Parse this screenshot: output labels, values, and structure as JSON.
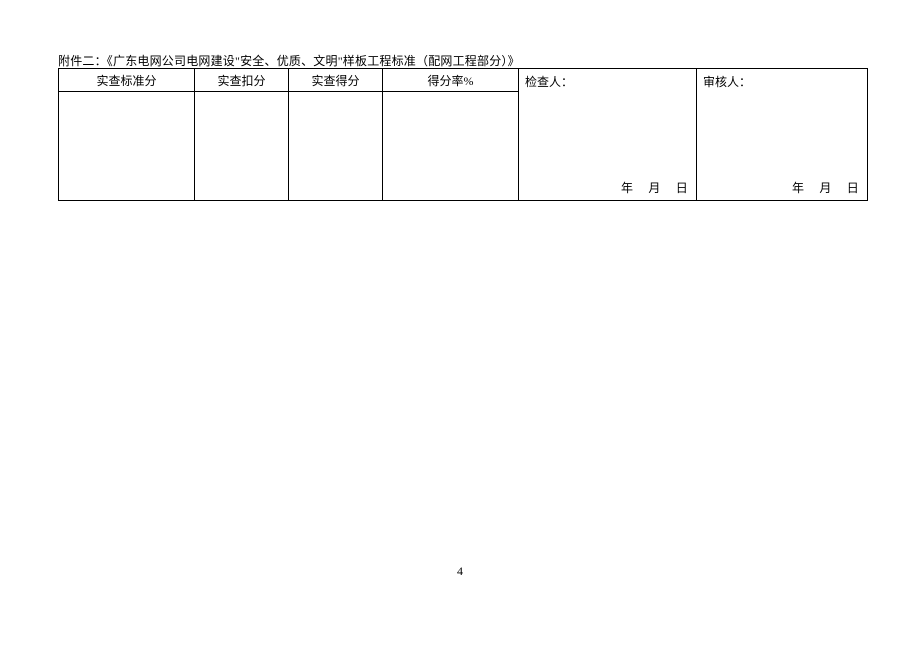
{
  "title_line": "附件二：《广东电网公司电网建设\"安全、优质、文明\"样板工程标准（配网工程部分）》",
  "table": {
    "headers": {
      "c1": "实查标准分",
      "c2": "实查扣分",
      "c3": "实查得分",
      "c4": "得分率%",
      "c5_label": "检查人：",
      "c6_label": "审核人："
    },
    "date_units": {
      "year": "年",
      "month": "月",
      "day": "日"
    }
  },
  "page_number": "4"
}
